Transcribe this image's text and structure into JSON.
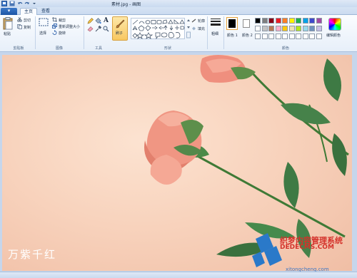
{
  "window": {
    "title": "素材.jpg - 画图"
  },
  "quick_access": {
    "icons": [
      "app-icon",
      "save-icon",
      "undo-icon",
      "redo-icon",
      "dropdown-icon"
    ]
  },
  "tabs": {
    "file": "▾",
    "home": "主页",
    "view": "查看"
  },
  "ribbon": {
    "clipboard": {
      "paste": "粘贴",
      "cut": "剪切",
      "copy": "复制",
      "label": "剪贴板"
    },
    "image": {
      "select": "选择",
      "crop": "裁剪",
      "resize": "重新调整大小",
      "rotate": "旋转",
      "label": "图像"
    },
    "tools": {
      "label": "工具",
      "text_tool": "A"
    },
    "brushes": {
      "label": "刷子"
    },
    "shapes": {
      "label": "形状",
      "outline": "轮廓",
      "fill": "填充"
    },
    "size": {
      "label": "粗细"
    },
    "colors": {
      "color1": "颜色 1",
      "color2": "颜色 2",
      "edit": "编辑颜色",
      "label": "颜色",
      "swatches": [
        "#000000",
        "#7f7f7f",
        "#880015",
        "#ed1c24",
        "#ff7f27",
        "#fff200",
        "#22b14c",
        "#00a2e8",
        "#3f48cc",
        "#a349a4",
        "#ffffff",
        "#c3c3c3",
        "#b97a57",
        "#ffaec9",
        "#ffc90e",
        "#efe4b0",
        "#b5e61d",
        "#99d9ea",
        "#7092be",
        "#c8bfe7",
        "#ffffff",
        "#ffffff",
        "#ffffff",
        "#ffffff",
        "#ffffff",
        "#ffffff",
        "#ffffff",
        "#ffffff",
        "#ffffff",
        "#ffffff"
      ]
    }
  },
  "canvas": {
    "artwork_text": "万紫千红",
    "watermark": {
      "brand": "织梦内容管理系统",
      "url": "DEDECMS.COM",
      "site": "xitongcheng.com"
    }
  }
}
